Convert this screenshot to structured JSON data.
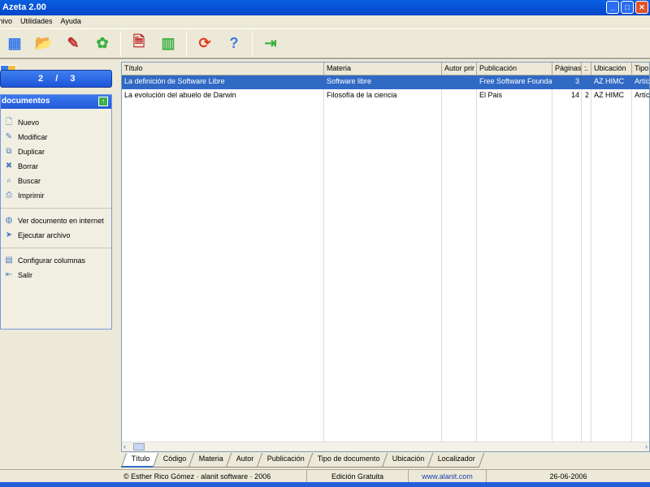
{
  "window": {
    "title": "Azeta 2.00"
  },
  "menu": [
    "chivo",
    "Utilidades",
    "Ayuda"
  ],
  "toolbar": [
    {
      "icon": "documents-grid-icon",
      "glyph": "▦",
      "color": "#3b7be8"
    },
    {
      "icon": "open-folder-icon",
      "glyph": "📂",
      "color": "#e8c040"
    },
    {
      "icon": "edit-pencil-icon",
      "glyph": "✎",
      "color": "#c03030"
    },
    {
      "icon": "award-ribbon-icon",
      "glyph": "✿",
      "color": "#3cb043"
    },
    {
      "sep": true
    },
    {
      "icon": "certificate-document-icon",
      "glyph": "🗎",
      "color": "#c03030"
    },
    {
      "icon": "green-cabinet-icon",
      "glyph": "▥",
      "color": "#3cb043"
    },
    {
      "sep": true
    },
    {
      "icon": "refresh-arrows-icon",
      "glyph": "⟳",
      "color": "#e04020"
    },
    {
      "icon": "help-icon",
      "glyph": "?",
      "color": "#3a7ae0"
    },
    {
      "sep": true
    },
    {
      "icon": "exit-door-icon",
      "glyph": "⇥",
      "color": "#3cb043"
    }
  ],
  "counter": {
    "current": "2",
    "sep": "/",
    "total": "3"
  },
  "panel": {
    "title": "documentos",
    "groups": [
      [
        {
          "label": "Nuevo",
          "icon": "new-document-icon",
          "glyph": "🗋"
        },
        {
          "label": "Modificar",
          "icon": "modify-icon",
          "glyph": "✎"
        },
        {
          "label": "Duplicar",
          "icon": "duplicate-icon",
          "glyph": "⧉"
        },
        {
          "label": "Borrar",
          "icon": "delete-icon",
          "glyph": "✖"
        },
        {
          "label": "Buscar",
          "icon": "search-icon",
          "glyph": "⌕"
        },
        {
          "label": "Imprimir",
          "icon": "print-icon",
          "glyph": "⎙"
        }
      ],
      [
        {
          "label": "Ver documento en internet",
          "icon": "globe-icon",
          "glyph": "◍"
        },
        {
          "label": "Ejecutar archivo",
          "icon": "run-file-icon",
          "glyph": "➤"
        }
      ],
      [
        {
          "label": "Configurar columnas",
          "icon": "columns-icon",
          "glyph": "▤"
        },
        {
          "label": "Salir",
          "icon": "exit-icon",
          "glyph": "⇤"
        }
      ]
    ]
  },
  "table": {
    "columns": [
      "Título",
      "Materia",
      "Autor prir",
      "Publicación",
      "Páginas",
      ":.",
      "Ubicación",
      "Tipo"
    ],
    "rows": [
      [
        "La definición de Software Libre",
        "Software libre",
        "",
        "Free Software Foundat",
        "3",
        "",
        "AZ HIMC",
        "Artíc"
      ],
      [
        "La evolución del abuelo de Darwin",
        "Filosofía de la ciencia",
        "",
        "El Pais",
        "14",
        "2",
        "AZ HIMC",
        "Artíc"
      ]
    ],
    "selected_row": 0
  },
  "tabs": [
    "Título",
    "Código",
    "Materia",
    "Autor",
    "Publicación",
    "Tipo de documento",
    "Ubicación",
    "Localizador"
  ],
  "active_tab": 0,
  "status": {
    "copyright": "© Esther Rico Gómez · alanit software · 2006",
    "edition": "Edición Gratuita",
    "url": "www.alanit.com",
    "date": "26-06-2006"
  }
}
